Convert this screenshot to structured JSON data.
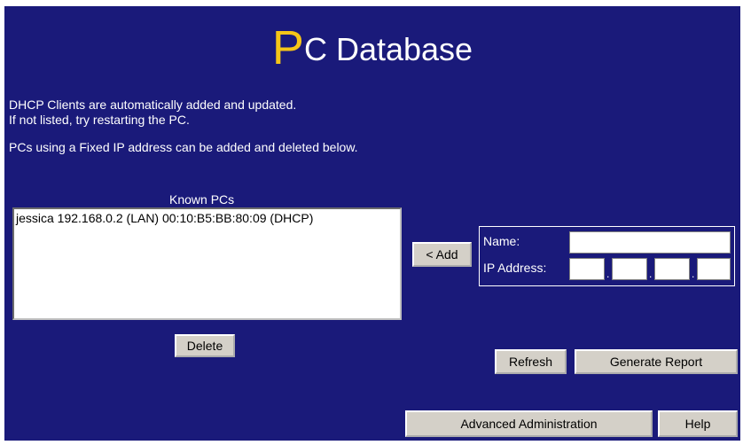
{
  "title": {
    "first_letter": "P",
    "rest": "C Database"
  },
  "intro": {
    "line1": "DHCP Clients are automatically added and updated.",
    "line2": "If not listed, try restarting the PC.",
    "line3": "PCs using a Fixed IP address can be added and deleted below."
  },
  "known_pcs": {
    "label": "Known PCs",
    "items": [
      "jessica 192.168.0.2 (LAN) 00:10:B5:BB:80:09 (DHCP)"
    ]
  },
  "buttons": {
    "add": "< Add",
    "delete": "Delete",
    "refresh": "Refresh",
    "generate_report": "Generate Report",
    "advanced": "Advanced Administration",
    "help": "Help"
  },
  "form": {
    "name_label": "Name:",
    "ip_label": "IP Address:",
    "name_value": "",
    "ip_octets": [
      "",
      "",
      "",
      ""
    ],
    "ip_separator": "."
  },
  "colors": {
    "background": "#1a1a7a",
    "title_accent": "#f5c518",
    "button": "#d4d0c8"
  }
}
